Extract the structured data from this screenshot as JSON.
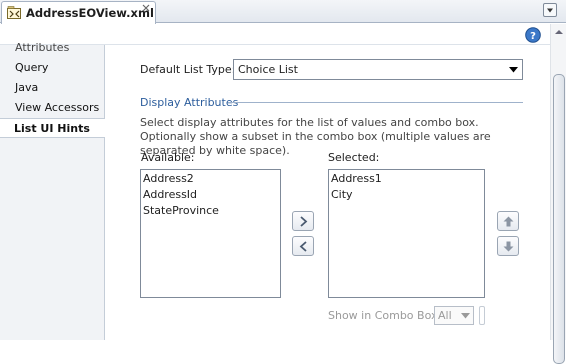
{
  "tab": {
    "title": "AddressEOView.xml"
  },
  "sidebar": {
    "items": [
      "Attributes",
      "Query",
      "Java",
      "View Accessors",
      "List UI Hints"
    ],
    "active": "List UI Hints"
  },
  "form": {
    "default_list_type_label": "Default List Type:",
    "default_list_type_value": "Choice List",
    "section_title": "Display Attributes",
    "description": "Select display attributes for the list of values and combo box. Optionally show a subset in the combo box (multiple values are separated by white space).",
    "available_label": "Available:",
    "selected_label": "Selected:",
    "available_items": [
      "Address2",
      "AddressId",
      "StateProvince"
    ],
    "selected_items": [
      "Address1",
      "City"
    ],
    "show_in_combo_label": "Show in Combo Box:",
    "show_in_combo_value": "All"
  },
  "colors": {
    "section_title": "#2c5d9c",
    "active_nav_bg": "#ffffff",
    "sidebar_bg": "#f1f3f6"
  },
  "icons": [
    "xml-file-icon",
    "close-icon",
    "tab-list-icon",
    "help-icon",
    "move-right-icon",
    "move-left-icon",
    "move-up-icon",
    "move-down-icon",
    "chevron-down-icon"
  ]
}
